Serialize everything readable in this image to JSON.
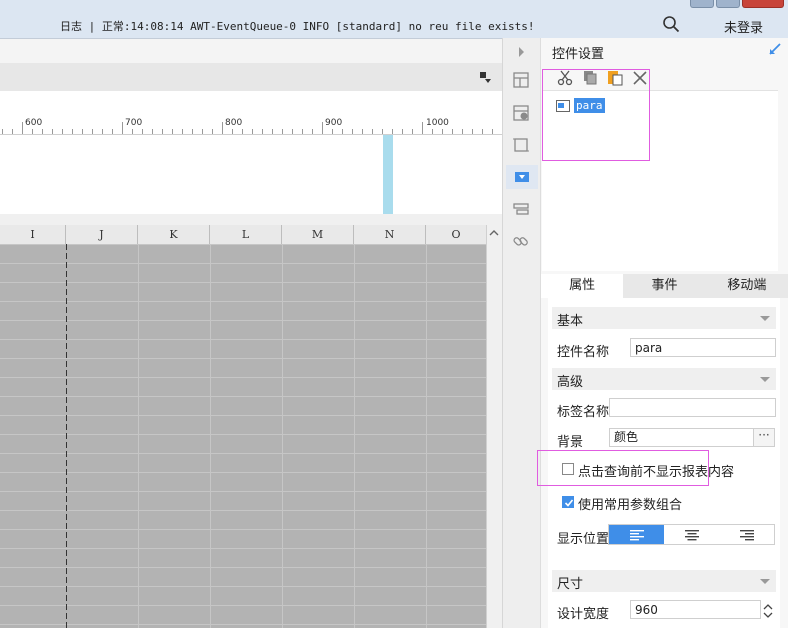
{
  "statusbar": {
    "log_message": "日志 | 正常:14:08:14 AWT-EventQueue-0 INFO [standard] no reu file exists!",
    "search_icon": "search-icon",
    "login_label": "未登录"
  },
  "ruler": {
    "labels": [
      "600",
      "700",
      "800",
      "900",
      "1000"
    ]
  },
  "spreadsheet": {
    "columns": [
      "I",
      "J",
      "K",
      "L",
      "M",
      "N",
      "O"
    ]
  },
  "side_icons": [
    "form-layout-icon",
    "form-info-icon",
    "frame-icon",
    "widget-select-icon",
    "toolbar-icon",
    "link-icon"
  ],
  "panel": {
    "title": "控件设置",
    "toolbar": [
      "cut-icon",
      "copy-icon",
      "paste-icon",
      "delete-icon"
    ],
    "tree_node": "para",
    "tabs": [
      {
        "label": "属性",
        "active": true
      },
      {
        "label": "事件",
        "active": false
      },
      {
        "label": "移动端",
        "active": false
      }
    ],
    "sections": {
      "basic": "基本",
      "advanced": "高级",
      "size": "尺寸"
    },
    "fields": {
      "widget_name_label": "控件名称",
      "widget_name_value": "para",
      "tag_name_label": "标签名称",
      "tag_name_value": "",
      "background_label": "背景",
      "background_value": "颜色",
      "more_label": "···",
      "hide_before_query_label": "点击查询前不显示报表内容",
      "hide_before_query_checked": false,
      "use_common_params_label": "使用常用参数组合",
      "use_common_params_checked": true,
      "display_position_label": "显示位置",
      "display_position_options": [
        "align-left-icon",
        "align-center-icon",
        "align-right-icon"
      ],
      "display_position_selected": 0,
      "design_width_label": "设计宽度",
      "design_width_value": "960"
    }
  },
  "colors": {
    "accent": "#3f8ee8",
    "highlight": "#e05ce0",
    "grid": "#b3b3b3",
    "canvas_marker": "#a9dced"
  }
}
